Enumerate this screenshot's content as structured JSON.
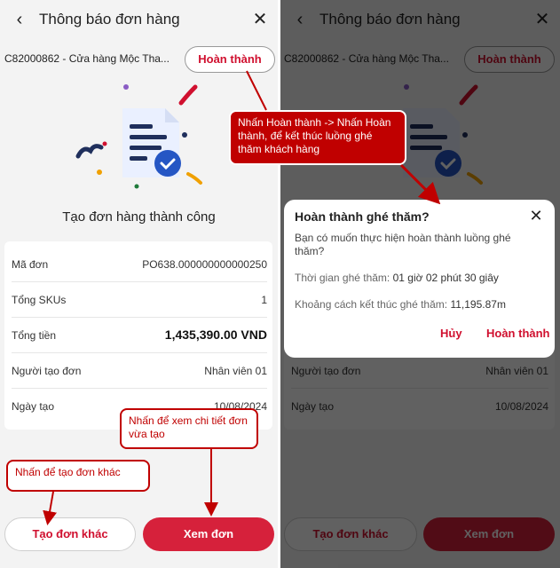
{
  "header": {
    "title": "Thông báo đơn hàng",
    "back_icon": "‹",
    "close_icon": "✕"
  },
  "store": {
    "name": "C82000862 - Cửa hàng Mộc Tha...",
    "complete_button": "Hoàn thành"
  },
  "success_message": "Tạo đơn hàng thành công",
  "order": {
    "rows": [
      {
        "label": "Mã đơn",
        "value": "PO638.000000000000250"
      },
      {
        "label": "Tổng SKUs",
        "value": "1"
      },
      {
        "label": "Tổng tiền",
        "value": "1,435,390.00 VND"
      },
      {
        "label": "Người tạo đơn",
        "value": "Nhân viên 01"
      },
      {
        "label": "Ngày tạo",
        "value": "10/08/2024"
      }
    ]
  },
  "actions": {
    "new_order": "Tạo đơn khác",
    "view_order": "Xem đơn"
  },
  "dialog": {
    "title": "Hoàn thành ghé thăm?",
    "message": "Bạn có muốn thực hiện hoàn thành luồng ghé thăm?",
    "time_label": "Thời gian ghé thăm:",
    "time_value": "01 giờ 02 phút 30 giây",
    "distance_label": "Khoảng cách kết thúc ghé thăm:",
    "distance_value": "11,195.87m",
    "cancel": "Hủy",
    "confirm": "Hoàn thành"
  },
  "callouts": {
    "complete": "Nhấn Hoàn thành -> Nhấn Hoàn thành, để kết thúc luồng ghé thăm khách hàng",
    "view": "Nhấn để xem chi tiết đơn vừa tạo",
    "new": "Nhấn để tạo đơn khác"
  },
  "colors": {
    "brand_red": "#d6213b",
    "annotation_red": "#c00000"
  }
}
